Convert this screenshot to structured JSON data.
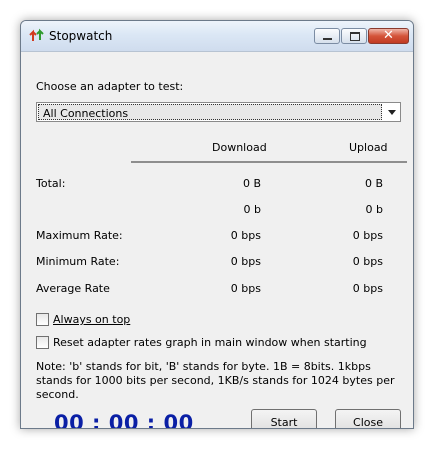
{
  "window": {
    "title": "Stopwatch",
    "icon": "stopwatch-arrows-icon",
    "controls": {
      "minimize": "minimize-icon",
      "maximize": "maximize-icon",
      "close": "close-icon"
    }
  },
  "adapter": {
    "label": "Choose an adapter to test:",
    "selected": "All Connections"
  },
  "columns": {
    "download": "Download",
    "upload": "Upload"
  },
  "rows": {
    "total": {
      "label": "Total:",
      "download": "0 B",
      "upload": "0 B"
    },
    "total_bits": {
      "download": "0 b",
      "upload": "0 b"
    },
    "max_rate": {
      "label": "Maximum Rate:",
      "download": "0 bps",
      "upload": "0 bps"
    },
    "min_rate": {
      "label": "Minimum Rate:",
      "download": "0 bps",
      "upload": "0 bps"
    },
    "avg_rate": {
      "label": "Average Rate",
      "download": "0 bps",
      "upload": "0 bps"
    }
  },
  "options": {
    "always_on_top": {
      "label": "Always on top",
      "checked": false
    },
    "reset_graph": {
      "label": "Reset adapter rates graph in main window when starting",
      "checked": false
    }
  },
  "note": "Note: 'b' stands for bit, 'B' stands for byte. 1B = 8bits. 1kbps stands for 1000 bits per second, 1KB/s stands for 1024 bytes per second.",
  "timer": "00 : 00 : 00",
  "buttons": {
    "start": "Start",
    "close": "Close"
  },
  "colors": {
    "timer": "#0a1fa5",
    "title_bar": "#dbe7f5",
    "close_button": "#c13a22"
  }
}
